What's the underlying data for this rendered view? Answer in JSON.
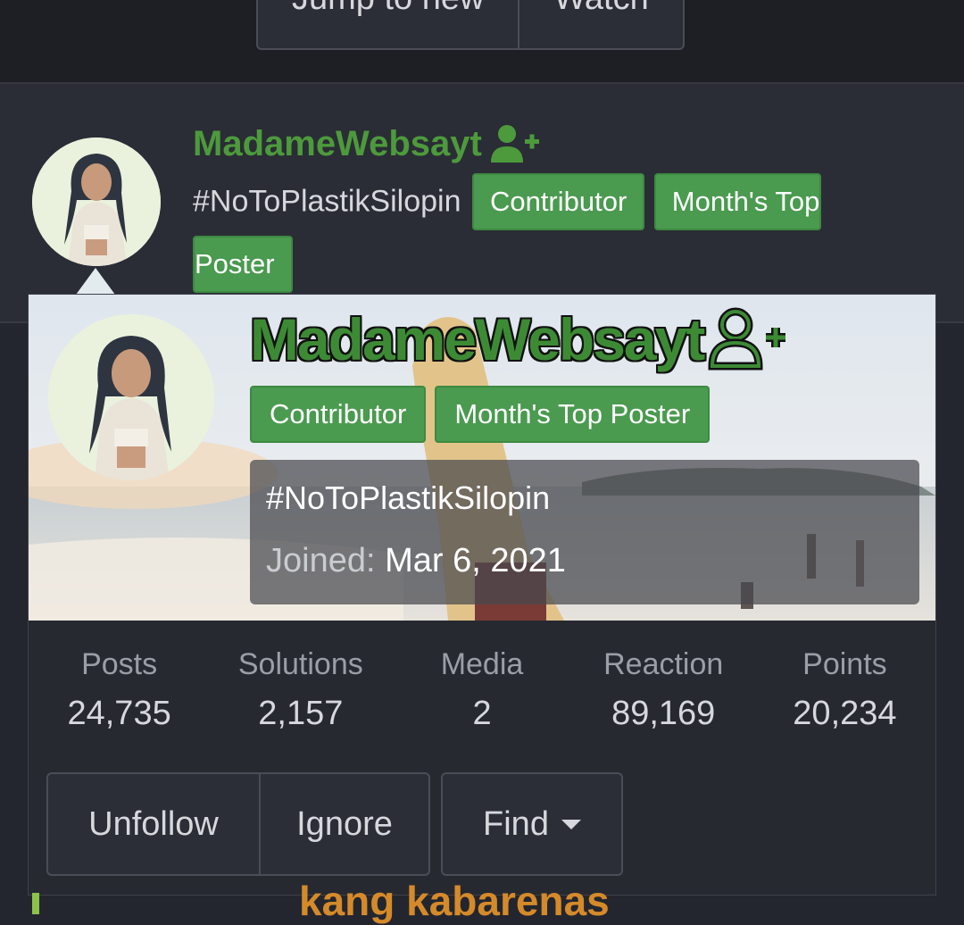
{
  "toolbar": {
    "jump_label": "Jump to new",
    "watch_label": "Watch"
  },
  "post": {
    "username": "MadameWebsayt",
    "user_title": "#NoToPlastikSilopin",
    "badges": [
      "Contributor",
      "Month's Top",
      "Poster"
    ]
  },
  "member_card": {
    "username": "MadameWebsayt",
    "badges": [
      "Contributor",
      "Month's Top Poster"
    ],
    "user_title": "#NoToPlastikSilopin",
    "joined_label": "Joined:",
    "joined_value": "Mar 6, 2021",
    "stats": [
      {
        "label": "Posts",
        "value": "24,735"
      },
      {
        "label": "Solutions",
        "value": "2,157"
      },
      {
        "label": "Media",
        "value": "2"
      },
      {
        "label": "Reaction",
        "value": "89,169"
      },
      {
        "label": "Points",
        "value": "20,234"
      }
    ],
    "actions": {
      "unfollow": "Unfollow",
      "ignore": "Ignore",
      "find": "Find"
    }
  },
  "bottom_text": "kang kabarenas",
  "colors": {
    "background": "#23262e",
    "username_green": "#4d9a3c",
    "badge_green": "#4a9a4f",
    "bottom_text_orange": "#d58a2a"
  },
  "icons": [
    "follow-user-icon",
    "caret-down-icon"
  ]
}
